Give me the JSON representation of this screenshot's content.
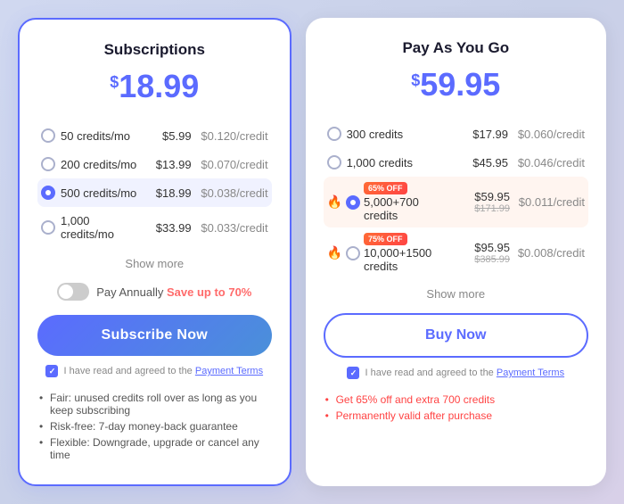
{
  "left_card": {
    "title": "Subscriptions",
    "price_currency": "$",
    "price_amount": "18.99",
    "options": [
      {
        "id": "opt1",
        "label": "50 credits/mo",
        "price": "$5.99",
        "per_credit": "$0.120/credit",
        "selected": false
      },
      {
        "id": "opt2",
        "label": "200 credits/mo",
        "price": "$13.99",
        "per_credit": "$0.070/credit",
        "selected": false
      },
      {
        "id": "opt3",
        "label": "500 credits/mo",
        "price": "$18.99",
        "per_credit": "$0.038/credit",
        "selected": true
      },
      {
        "id": "opt4",
        "label": "1,000 credits/mo",
        "price": "$33.99",
        "per_credit": "$0.033/credit",
        "selected": false
      }
    ],
    "show_more": "Show more",
    "toggle_label": "Pay Annually",
    "save_text": "Save up to 70%",
    "subscribe_btn": "Subscribe Now",
    "terms_text": "I have read and agreed to the",
    "terms_link": "Payment Terms",
    "bullets": [
      "Fair: unused credits roll over as long as you keep subscribing",
      "Risk-free: 7-day money-back guarantee",
      "Flexible: Downgrade, upgrade or cancel any time"
    ]
  },
  "right_card": {
    "title": "Pay As You Go",
    "price_currency": "$",
    "price_amount": "59.95",
    "options": [
      {
        "id": "ropt1",
        "label": "300 credits",
        "price": "$17.99",
        "per_credit": "$0.060/credit",
        "selected": false,
        "badge": null,
        "fire": false,
        "strikethrough": null
      },
      {
        "id": "ropt2",
        "label": "1,000 credits",
        "price": "$45.95",
        "per_credit": "$0.046/credit",
        "selected": false,
        "badge": null,
        "fire": false,
        "strikethrough": null
      },
      {
        "id": "ropt3",
        "label": "5,000+700 credits",
        "price": "$59.95",
        "per_credit": "$0.011/credit",
        "selected": true,
        "badge": "65% OFF",
        "fire": true,
        "strikethrough": "$171.99"
      },
      {
        "id": "ropt4",
        "label": "10,000+1500 credits",
        "price": "$95.95",
        "per_credit": "$0.008/credit",
        "selected": false,
        "badge": "75% OFF",
        "fire": true,
        "strikethrough": "$385.99"
      }
    ],
    "show_more": "Show more",
    "buy_btn": "Buy Now",
    "terms_text": "I have read and agreed to the",
    "terms_link": "Payment Terms",
    "promo_bullets": [
      "Get 65% off and extra 700 credits",
      "Permanently valid after purchase"
    ]
  }
}
